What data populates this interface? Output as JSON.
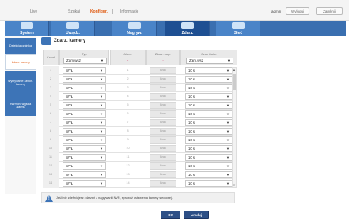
{
  "top_menu": {
    "items": [
      "Live",
      "Szukaj",
      "Konfigur.",
      "Informacje"
    ],
    "active_index": 2,
    "user": "admin",
    "buttons": [
      "Wyloguj",
      "Zamknij"
    ]
  },
  "categories": [
    {
      "label": "System",
      "icon": "system-icon"
    },
    {
      "label": "Urządz.",
      "icon": "device-icon"
    },
    {
      "label": "Nagryw.",
      "icon": "record-icon"
    },
    {
      "label": "Zdarz.",
      "icon": "event-icon"
    },
    {
      "label": "Sieć",
      "icon": "network-icon"
    }
  ],
  "active_category": 3,
  "sidebar": [
    {
      "label": "Detekcja czujnika"
    },
    {
      "label": "Zdarz. kamery"
    },
    {
      "label": "Wykrywanie zasłon. kamery"
    },
    {
      "label": "Harmon. wyjścia alarmu"
    }
  ],
  "active_sidebar": 1,
  "panel": {
    "title": "Zdarz. kamery"
  },
  "table": {
    "headers": {
      "no": "Kanał",
      "type": "Typ",
      "type_select": "Zam.wsz",
      "alarm": "Alarm",
      "alarm_sub": "-",
      "rec": "Zdarz. nagr.",
      "rec_sub": "-",
      "time": "Czas ti.alar.",
      "time_select": "Zam.wsz"
    },
    "rows": [
      {
        "no": "1",
        "type": "WYŁ",
        "alarm": "1",
        "rec": "Brak",
        "time": "10 s"
      },
      {
        "no": "2",
        "type": "WYŁ",
        "alarm": "2",
        "rec": "Brak",
        "time": "10 s"
      },
      {
        "no": "3",
        "type": "WYŁ",
        "alarm": "3",
        "rec": "Brak",
        "time": "10 s"
      },
      {
        "no": "4",
        "type": "WYŁ",
        "alarm": "4",
        "rec": "Brak",
        "time": "10 s"
      },
      {
        "no": "5",
        "type": "WYŁ",
        "alarm": "5",
        "rec": "Brak",
        "time": "10 s"
      },
      {
        "no": "6",
        "type": "WYŁ",
        "alarm": "6",
        "rec": "Brak",
        "time": "10 s"
      },
      {
        "no": "7",
        "type": "WYŁ",
        "alarm": "7",
        "rec": "Brak",
        "time": "10 s"
      },
      {
        "no": "8",
        "type": "WYŁ",
        "alarm": "8",
        "rec": "Brak",
        "time": "10 s"
      },
      {
        "no": "9",
        "type": "WYŁ",
        "alarm": "9",
        "rec": "Brak",
        "time": "10 s"
      },
      {
        "no": "10",
        "type": "WYŁ",
        "alarm": "10",
        "rec": "Brak",
        "time": "10 s"
      },
      {
        "no": "11",
        "type": "WYŁ",
        "alarm": "11",
        "rec": "Brak",
        "time": "10 s"
      },
      {
        "no": "12",
        "type": "WYŁ",
        "alarm": "12",
        "rec": "Brak",
        "time": "10 s"
      },
      {
        "no": "13",
        "type": "WYŁ",
        "alarm": "13",
        "rec": "Brak",
        "time": "10 s"
      },
      {
        "no": "14",
        "type": "WYŁ",
        "alarm": "14",
        "rec": "Brak",
        "time": "10 s"
      }
    ]
  },
  "note": "Jeśli nie zdefiniujesz zdarzeń z nagrywarki NVR, sprawdź ustawienia kamery sieciowej.",
  "buttons": {
    "ok": "OK",
    "cancel": "Anuluj"
  },
  "colors": {
    "accent": "#e05a10",
    "nav": "#3d74b7",
    "button": "#2d4f86"
  }
}
